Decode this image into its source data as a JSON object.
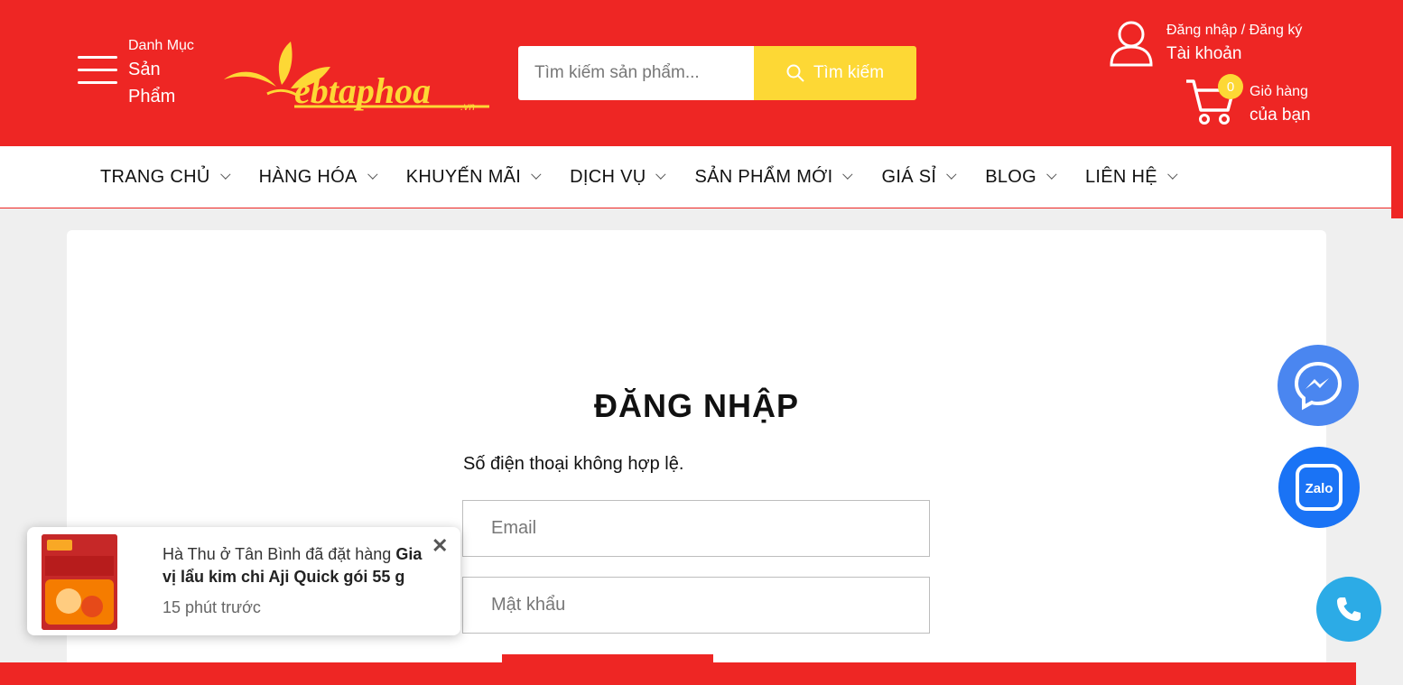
{
  "header": {
    "menu_small": "Danh Mục",
    "menu_big": "Sản Phẩm",
    "search_placeholder": "Tìm kiếm sản phẩm...",
    "search_button": "Tìm kiếm",
    "account_small": "Đăng nhập / Đăng ký",
    "account_big": "Tài khoản",
    "cart_count": "0",
    "cart_small": "Giỏ hàng",
    "cart_big": "của bạn",
    "logo_text": "webtaphoa.vn"
  },
  "nav": {
    "items": [
      {
        "label": "TRANG CHỦ"
      },
      {
        "label": "HÀNG HÓA"
      },
      {
        "label": "KHUYẾN MÃI"
      },
      {
        "label": "DỊCH VỤ"
      },
      {
        "label": "SẢN PHẨM MỚI"
      },
      {
        "label": "GIÁ SỈ"
      },
      {
        "label": "BLOG"
      },
      {
        "label": "LIÊN HỆ"
      }
    ]
  },
  "login": {
    "title": "ĐĂNG NHẬP",
    "error": "Số điện thoại không hợp lệ.",
    "email_placeholder": "Email",
    "password_placeholder": "Mật khẩu"
  },
  "toast": {
    "message_prefix": "Hà Thu ở Tân Bình đã đặt hàng ",
    "product": "Gia vị lẩu kim chi Aji Quick gói 55 g",
    "time": "15 phút trước",
    "close": "✕"
  },
  "colors": {
    "brand_red": "#ee2624",
    "accent_yellow": "#fdd835",
    "messenger_blue": "#4a86f0",
    "zalo_blue": "#1a73f5",
    "phone_blue": "#2cabe6"
  }
}
